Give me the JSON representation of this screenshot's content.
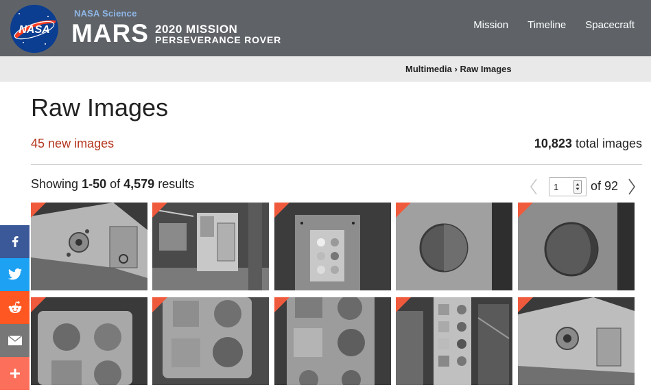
{
  "header": {
    "logo_text": "NASA",
    "brand_small": "NASA Science",
    "brand_big": "MARS",
    "brand_mission": "2020 MISSION",
    "brand_rover": "PERSEVERANCE ROVER",
    "nav": [
      "Mission",
      "Timeline",
      "Spacecraft"
    ]
  },
  "breadcrumb": {
    "items": [
      "Multimedia",
      "Raw Images"
    ],
    "separator": "›"
  },
  "page": {
    "title": "Raw Images",
    "new_count": "45",
    "new_label": "new images",
    "total_count": "10,823",
    "total_label": "total images",
    "showing_prefix": "Showing",
    "showing_range": "1-50",
    "showing_of": "of",
    "showing_total": "4,579",
    "showing_suffix": "results"
  },
  "pager": {
    "current_page": "1",
    "of_label": "of",
    "total_pages": "92"
  },
  "share": [
    "facebook-icon",
    "twitter-icon",
    "reddit-icon",
    "email-icon",
    "plus-icon"
  ],
  "colors": {
    "header_bg": "#5f6368",
    "accent_red": "#b4371f",
    "new_flag": "#f05a3c",
    "facebook": "#3b5998",
    "twitter": "#1da1f2",
    "reddit": "#ff5722",
    "email": "#777777",
    "more": "#fb6f5b"
  },
  "thumbnails": [
    {
      "subject": "rover-body-with-fasteners",
      "is_new": true
    },
    {
      "subject": "rover-deck-with-mast",
      "is_new": true
    },
    {
      "subject": "calibration-target-plate",
      "is_new": true
    },
    {
      "subject": "sample-cup-top-view",
      "is_new": true
    },
    {
      "subject": "sample-cup-shadowed",
      "is_new": true
    },
    {
      "subject": "plate-with-four-wells",
      "is_new": true
    },
    {
      "subject": "plate-with-textured-wells",
      "is_new": true
    },
    {
      "subject": "plate-with-sample-wells",
      "is_new": true
    },
    {
      "subject": "calibration-strip-with-cables",
      "is_new": true
    },
    {
      "subject": "rover-body-closeup",
      "is_new": true
    }
  ]
}
